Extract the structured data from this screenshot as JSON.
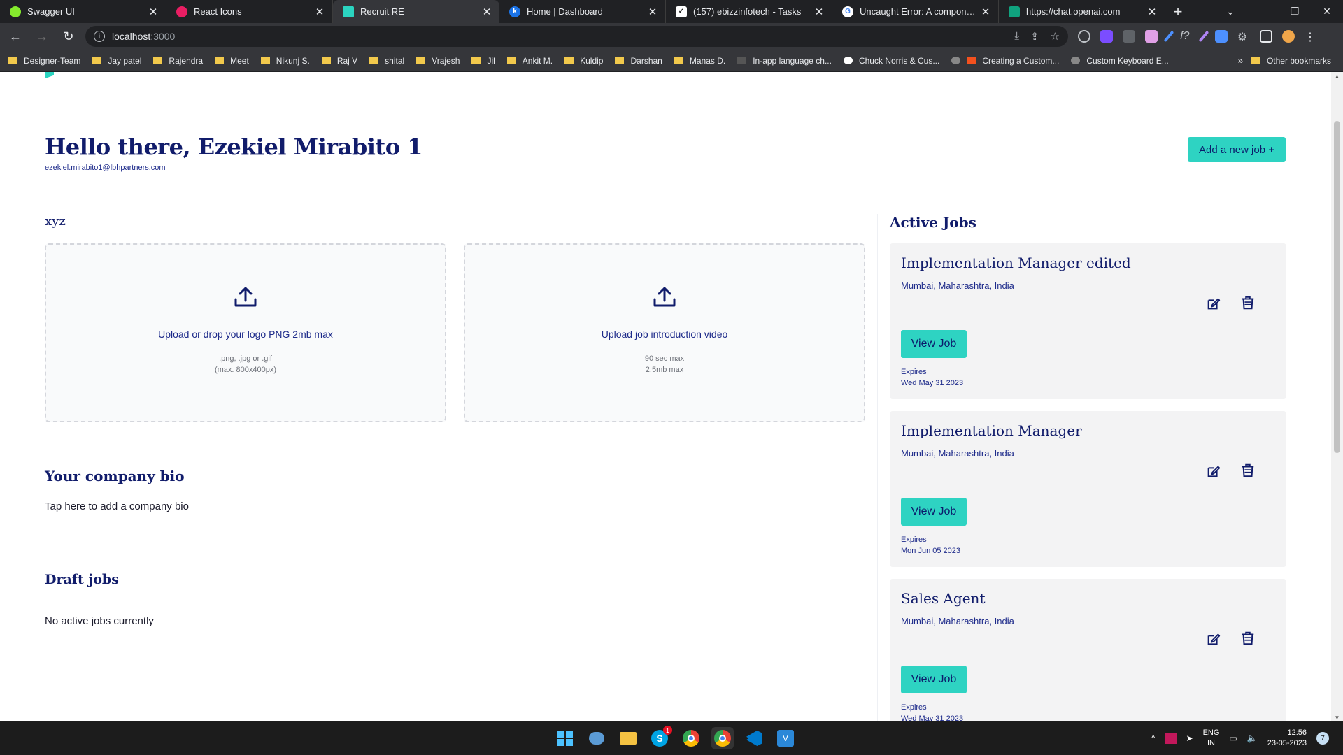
{
  "browser": {
    "tabs": [
      {
        "title": "Swagger UI",
        "favicon_color": "#85ea2d",
        "active": false
      },
      {
        "title": "React Icons",
        "favicon_color": "#e91e63",
        "active": false
      },
      {
        "title": "Recruit RE",
        "favicon_color": "#2bd4c0",
        "active": true
      },
      {
        "title": "Home | Dashboard",
        "favicon_color": "#1a73e8",
        "active": false
      },
      {
        "title": "(157) ebizzinfotech - Tasks",
        "favicon_color": "#ffffff",
        "active": false
      },
      {
        "title": "Uncaught Error: A component s",
        "favicon_color": "#4285f4",
        "active": false
      },
      {
        "title": "https://chat.openai.com",
        "favicon_color": "#10a37f",
        "active": false
      }
    ],
    "url_host": "localhost",
    "url_port": ":3000",
    "bookmarks": [
      "Designer-Team",
      "Jay patel",
      "Rajendra",
      "Meet",
      "Nikunj S.",
      "Raj V",
      "shital",
      "Vrajesh",
      "Jil",
      "Ankit M.",
      "Kuldip",
      "Darshan",
      "Manas D.",
      "In-app language ch...",
      "Chuck Norris & Cus...",
      "Creating a Custom...",
      "Custom Keyboard E..."
    ],
    "other_bookmarks": "Other bookmarks",
    "more": "»"
  },
  "page": {
    "greeting": "Hello there, Ezekiel Mirabito 1",
    "email": "ezekiel.mirabito1@lbhpartners.com",
    "add_job_label": "Add a new job +",
    "section_title": "xyz",
    "upload_logo": {
      "title": "Upload or drop your logo PNG 2mb max",
      "line1": ".png, .jpg or .gif",
      "line2": "(max. 800x400px)"
    },
    "upload_video": {
      "title": "Upload job introduction video",
      "line1": "90 sec max",
      "line2": "2.5mb max"
    },
    "bio_title": "Your company bio",
    "bio_placeholder": "Tap here to add a company bio",
    "draft_title": "Draft jobs",
    "draft_empty": "No active jobs currently",
    "active_title": "Active Jobs",
    "jobs": [
      {
        "title": "Implementation Manager edited",
        "location": "Mumbai, Maharashtra, India",
        "view_label": "View Job",
        "expires_label": "Expires",
        "expires_date": "Wed May 31 2023"
      },
      {
        "title": "Implementation Manager",
        "location": "Mumbai, Maharashtra, India",
        "view_label": "View Job",
        "expires_label": "Expires",
        "expires_date": "Mon Jun 05 2023"
      },
      {
        "title": "Sales Agent",
        "location": "Mumbai, Maharashtra, India",
        "view_label": "View Job",
        "expires_label": "Expires",
        "expires_date": "Wed May 31 2023"
      }
    ],
    "accent_color": "#2ed3c2",
    "primary_color": "#111c6b"
  },
  "taskbar": {
    "skype_badge": "1",
    "lang_line1": "ENG",
    "lang_line2": "IN",
    "time": "12:56",
    "date": "23-05-2023",
    "notifications": "7"
  }
}
